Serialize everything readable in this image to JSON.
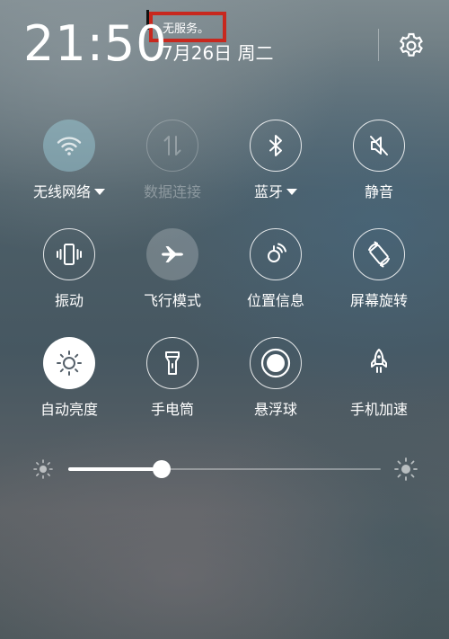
{
  "status": {
    "time": "21:50",
    "date": "7月26日 周二",
    "carrier": "无服务。"
  },
  "header": {
    "settings_icon": "gear-icon"
  },
  "quick_settings": {
    "tiles": [
      {
        "label": "无线网络",
        "icon": "wifi-icon",
        "state": "on",
        "has_dropdown": true
      },
      {
        "label": "数据连接",
        "icon": "data-arrows-icon",
        "state": "disabled",
        "has_dropdown": false
      },
      {
        "label": "蓝牙",
        "icon": "bluetooth-icon",
        "state": "off",
        "has_dropdown": true
      },
      {
        "label": "静音",
        "icon": "mute-icon",
        "state": "off",
        "has_dropdown": false
      },
      {
        "label": "振动",
        "icon": "vibrate-icon",
        "state": "off",
        "has_dropdown": false
      },
      {
        "label": "飞行模式",
        "icon": "airplane-icon",
        "state": "soft",
        "has_dropdown": false
      },
      {
        "label": "位置信息",
        "icon": "location-icon",
        "state": "off",
        "has_dropdown": false
      },
      {
        "label": "屏幕旋转",
        "icon": "rotate-icon",
        "state": "off",
        "has_dropdown": false
      },
      {
        "label": "自动亮度",
        "icon": "brightness-auto-icon",
        "state": "on",
        "has_dropdown": false
      },
      {
        "label": "手电筒",
        "icon": "flashlight-icon",
        "state": "off",
        "has_dropdown": false
      },
      {
        "label": "悬浮球",
        "icon": "floating-ball-icon",
        "state": "off",
        "has_dropdown": false
      },
      {
        "label": "手机加速",
        "icon": "rocket-icon",
        "state": "off",
        "has_dropdown": false
      }
    ]
  },
  "brightness": {
    "level": 0.3
  },
  "colors": {
    "active_fill": "#ffffff",
    "soft_fill": "#a0d2e1",
    "highlight_box": "#c8281e"
  }
}
